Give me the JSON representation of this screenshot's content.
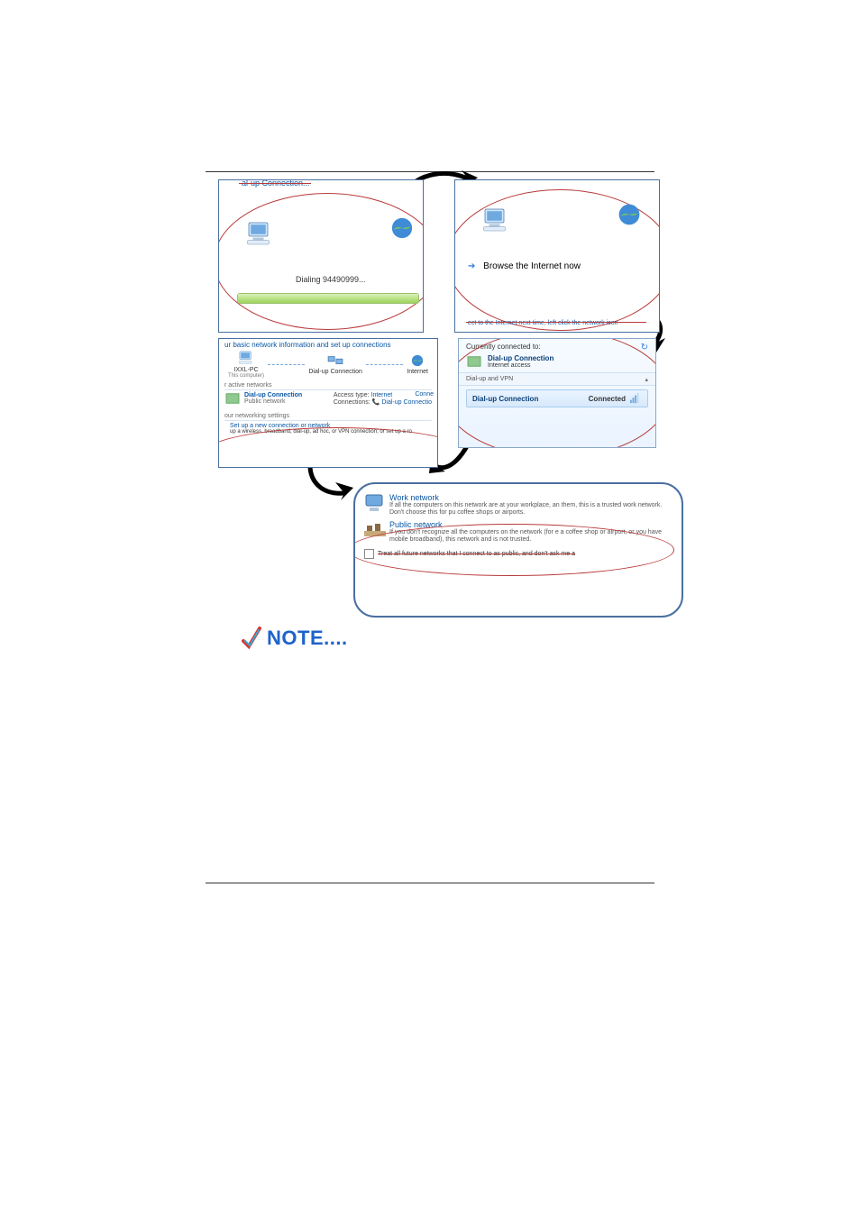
{
  "panel1": {
    "title": "al-up Connection...",
    "dialing": "Dialing 94490999..."
  },
  "panel2": {
    "browse": "Browse the Internet now",
    "hint": "ect to the Internet next time, left click the network icon"
  },
  "panel3": {
    "heading": "ur basic network information and set up connections",
    "node_pc": "IXXL-PC",
    "node_pc_sub": "This computer)",
    "node_mid": "Dial-up Connection",
    "node_net": "Internet",
    "see_full": "Conne",
    "active_section": "r active networks",
    "active_name": "Dial-up Connection",
    "active_type": "Public network",
    "access_label": "Access type:",
    "access_value": "Internet",
    "connections_label": "Connections:",
    "connections_value": "Dial-up Connectio",
    "settings_section": "our networking settings",
    "setup_link": "Set up a new connection or network",
    "setup_desc": "up a wireless, broadband, dial-up, ad hoc, or VPN connection; or set up a ro"
  },
  "panel4": {
    "heading": "Currently connected to:",
    "curr_name": "Dial-up Connection",
    "curr_sub": "Internet access",
    "section": "Dial-up and VPN",
    "conn_name": "Dial-up Connection",
    "conn_status": "Connected"
  },
  "panel5": {
    "work_title": "Work network",
    "work_desc": "If all the computers on this network are at your workplace, an them, this is a trusted work network. Don't choose this for pu coffee shops or airports.",
    "public_title": "Public network",
    "public_desc": "If you don't recognize all the computers on the network (for e a coffee shop or airport, or you have mobile broadband), this network and is not trusted.",
    "checkbox": "Treat all future networks that I connect to as public, and don't ask me a"
  },
  "note": "NOTE...."
}
